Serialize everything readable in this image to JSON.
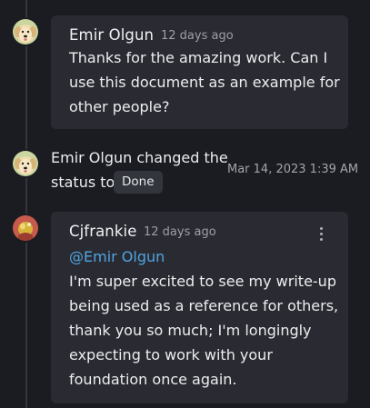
{
  "comments": [
    {
      "author": "Emir Olgun",
      "time": "12 days ago",
      "body": "Thanks for the amazing work. Can I\nuse this document as an example for\nother people?"
    },
    {
      "author": "Cjfrankie",
      "time": "12 days ago",
      "mention": "@Emir Olgun",
      "body": "I'm super excited to see my write-up\nbeing used as a reference for others,\nthank you so much; I'm longingly\nexpecting to work with your\nfoundation once again."
    }
  ],
  "status_change": {
    "line1": "Emir Olgun changed the",
    "line2": "status to",
    "status": "Done",
    "timestamp": "Mar 14, 2023 1:39 AM"
  },
  "colors": {
    "background": "#1b1c21",
    "card": "#2a2b32",
    "mention": "#4fa4e0"
  },
  "icons": {
    "menu": "more-vertical-icon"
  }
}
